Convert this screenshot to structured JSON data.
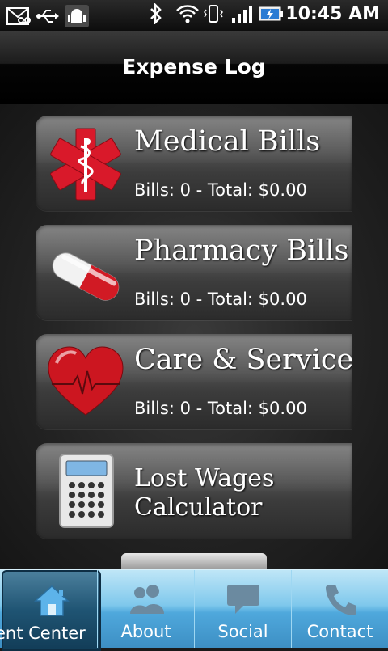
{
  "status_bar": {
    "time": "10:45 AM",
    "icons": [
      "voicemail-icon",
      "usb-icon",
      "android-debug-icon",
      "bluetooth-icon",
      "wifi-icon",
      "vibrate-icon",
      "signal-icon",
      "battery-charging-icon"
    ]
  },
  "header": {
    "title": "Expense Log"
  },
  "cards": [
    {
      "title": "Medical Bills",
      "subtitle": "Bills: 0 - Total: $0.00",
      "icon": "star-of-life-icon"
    },
    {
      "title": "Pharmacy Bills",
      "subtitle": "Bills: 0 - Total: $0.00",
      "icon": "pill-capsule-icon"
    },
    {
      "title": "Care & Services",
      "subtitle": "Bills: 0 - Total: $0.00",
      "icon": "heart-icon"
    },
    {
      "title": "Lost Wages Calculator",
      "icon": "calculator-icon"
    }
  ],
  "tabs": [
    {
      "label": "ent Center",
      "icon": "home-icon",
      "active": true
    },
    {
      "label": "About",
      "icon": "people-icon"
    },
    {
      "label": "Social",
      "icon": "speech-bubble-icon"
    },
    {
      "label": "Contact",
      "icon": "phone-icon"
    }
  ]
}
